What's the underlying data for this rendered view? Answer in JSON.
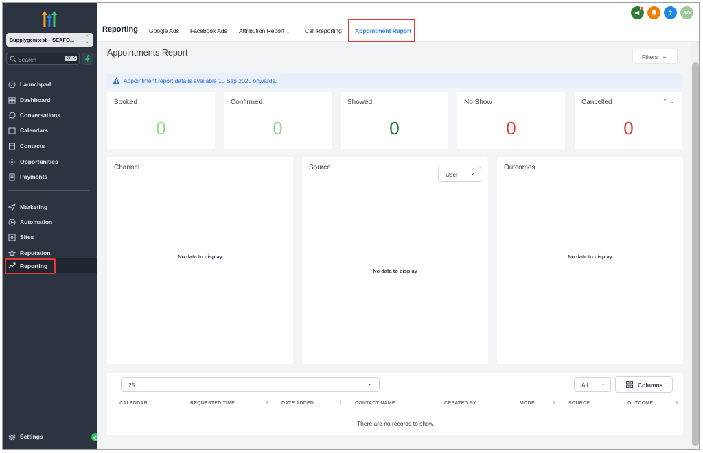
{
  "sidebar": {
    "account": "Supplygemtest – SEAFO...",
    "search_placeholder": "Search",
    "search_shortcut": "ctrl K",
    "items_top": [
      {
        "label": "Launchpad",
        "icon": "rocket-icon"
      },
      {
        "label": "Dashboard",
        "icon": "grid-icon"
      },
      {
        "label": "Conversations",
        "icon": "chat-icon"
      },
      {
        "label": "Calendars",
        "icon": "calendar-icon"
      },
      {
        "label": "Contacts",
        "icon": "contacts-icon"
      },
      {
        "label": "Opportunities",
        "icon": "opportunities-icon"
      },
      {
        "label": "Payments",
        "icon": "receipt-icon"
      }
    ],
    "items_bottom": [
      {
        "label": "Marketing",
        "icon": "send-icon"
      },
      {
        "label": "Automation",
        "icon": "automation-icon"
      },
      {
        "label": "Sites",
        "icon": "sites-icon"
      },
      {
        "label": "Reputation",
        "icon": "star-icon"
      },
      {
        "label": "Reporting",
        "icon": "trend-icon"
      }
    ],
    "settings": "Settings"
  },
  "topbar": {
    "title": "Reporting",
    "tabs": [
      "Google Ads",
      "Facebook Ads",
      "Attribution Report",
      "Call Reporting",
      "Appointment Report"
    ],
    "active_tab": "Appointment Report",
    "avatar_initials": "SG",
    "help_glyph": "?"
  },
  "main": {
    "page_title": "Appointments Report",
    "filters_label": "Filters",
    "notice": "Appointment report data is available 10 Sep 2020 onwards.",
    "stats": [
      {
        "label": "Booked",
        "value": "0",
        "color": "#8fd68f"
      },
      {
        "label": "Confirmed",
        "value": "0",
        "color": "#8fd68f"
      },
      {
        "label": "Showed",
        "value": "0",
        "color": "#1e7a2e"
      },
      {
        "label": "No Show",
        "value": "0",
        "color": "#e53935"
      },
      {
        "label": "Cancelled",
        "value": "0",
        "color": "#e53935"
      }
    ],
    "panels": [
      {
        "label": "Channel",
        "empty": "No data to display"
      },
      {
        "label": "Source",
        "empty": "No data to display",
        "select": "User"
      },
      {
        "label": "Outcomes",
        "empty": "No data to display"
      }
    ],
    "table": {
      "per_page": "25",
      "filter": "All",
      "columns_label": "Columns",
      "headers": [
        "CALENDAR",
        "REQUESTED TIME",
        "DATE ADDED",
        "CONTACT NAME",
        "CREATED BY",
        "MODE",
        "SOURCE",
        "OUTCOME"
      ],
      "empty": "There are no records to show"
    }
  },
  "colors": {
    "accent": "#2f80ed",
    "sidebar": "#2b3440",
    "highlight": "#e53935"
  }
}
